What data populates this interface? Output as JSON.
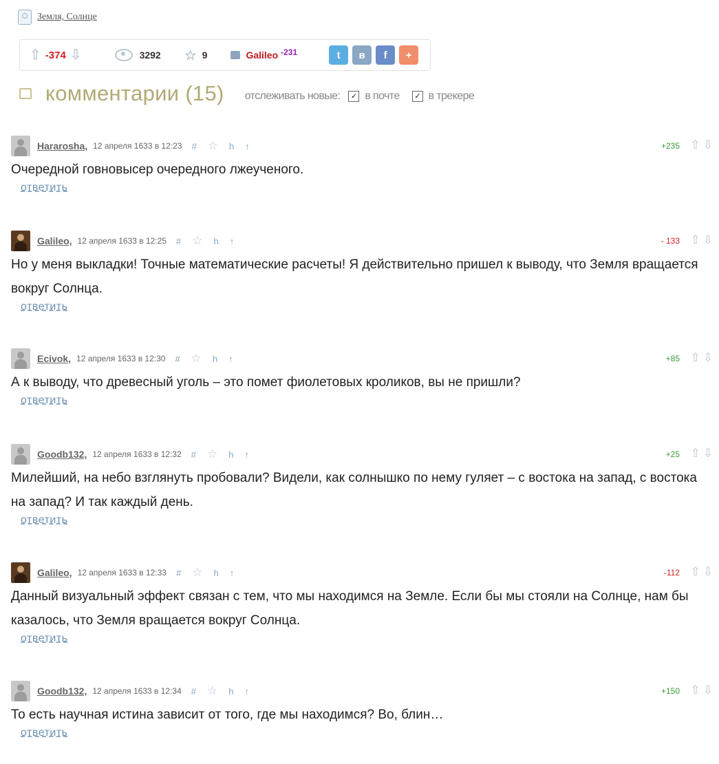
{
  "tags": {
    "text": "Земля, Солнце"
  },
  "infobar": {
    "score": "-374",
    "views": "3292",
    "favorites": "9",
    "author": "Galileo",
    "author_karma": "-231"
  },
  "comments_header": {
    "title": "комментарии (15)",
    "track_label": "отслеживать новые:",
    "mail_label": "в почте",
    "tracker_label": "в трекере"
  },
  "reply_label": "ответить",
  "comments": [
    {
      "user": "Hararosha,",
      "time": "12 апреля 1633 в 12:23",
      "score": "+235",
      "text": "Очередной говновысер очередного лжеученого."
    },
    {
      "user": "Galileo,",
      "time": "12 апреля 1633 в 12:25",
      "score": "- 133",
      "text": "Но у меня выкладки! Точные математические расчеты! Я действительно пришел к выводу, что Земля вращается вокруг Солнца."
    },
    {
      "user": "Ecivok,",
      "time": "12 апреля 1633 в 12:30",
      "score": "+85",
      "text": "А к выводу, что древесный уголь – это помет фиолетовых кроликов, вы не пришли?"
    },
    {
      "user": "Goodb132,",
      "time": "12 апреля 1633 в 12:32",
      "score": "+25",
      "text": "Милейший, на небо взглянуть пробовали? Видели, как солнышко по нему гуляет – с востока на запад, с востока на запад? И так каждый день."
    },
    {
      "user": "Galileo,",
      "time": "12 апреля 1633 в 12:33",
      "score": "-112",
      "text": "Данный визуальный эффект связан с тем, что мы находимся на Земле. Если бы мы стояли на Солнце, нам бы казалось, что Земля вращается вокруг Солнца."
    },
    {
      "user": "Goodb132,",
      "time": "12 апреля 1633 в 12:34",
      "score": "+150",
      "text": "То есть научная истина зависит от того, где мы находимся? Во, блин…"
    }
  ],
  "icons": {
    "hash": "#",
    "h": "h",
    "up": "↑",
    "vote_up": "⇧",
    "vote_down": "⇩",
    "checkmark": "✓"
  }
}
